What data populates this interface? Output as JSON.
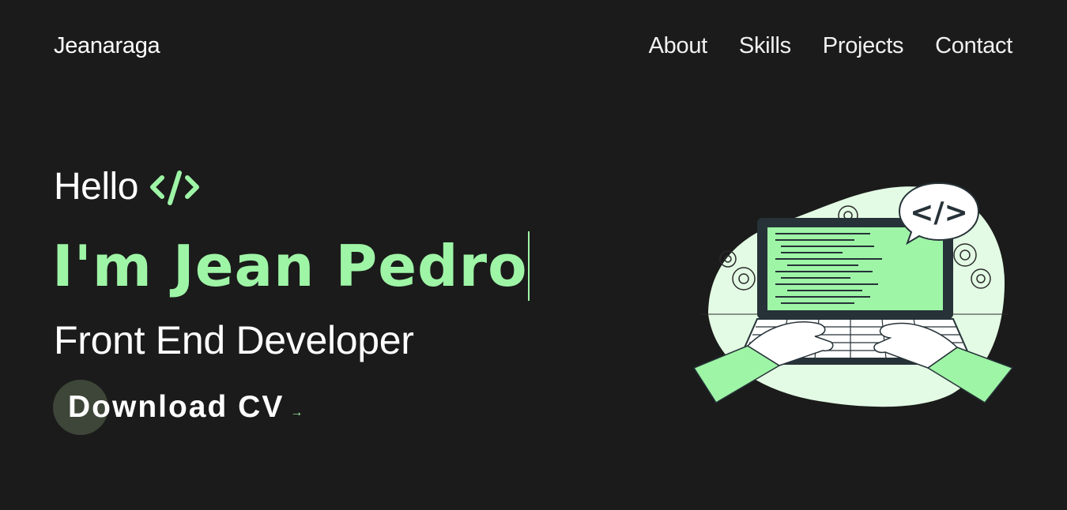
{
  "header": {
    "logo": "Jeanaraga",
    "nav": [
      "About",
      "Skills",
      "Projects",
      "Contact"
    ]
  },
  "hero": {
    "greeting": "Hello",
    "greeting_icon": "code-tag-icon",
    "name": "I'm Jean Pedro",
    "role": "Front End Developer",
    "cta_label": "Download CV",
    "cta_arrow": "→"
  },
  "illustration": {
    "subject": "developer-laptop-illustration",
    "bubble_text": "</>"
  },
  "colors": {
    "background": "#1b1b1b",
    "accent": "#9ef5a6",
    "text": "#ffffff"
  }
}
